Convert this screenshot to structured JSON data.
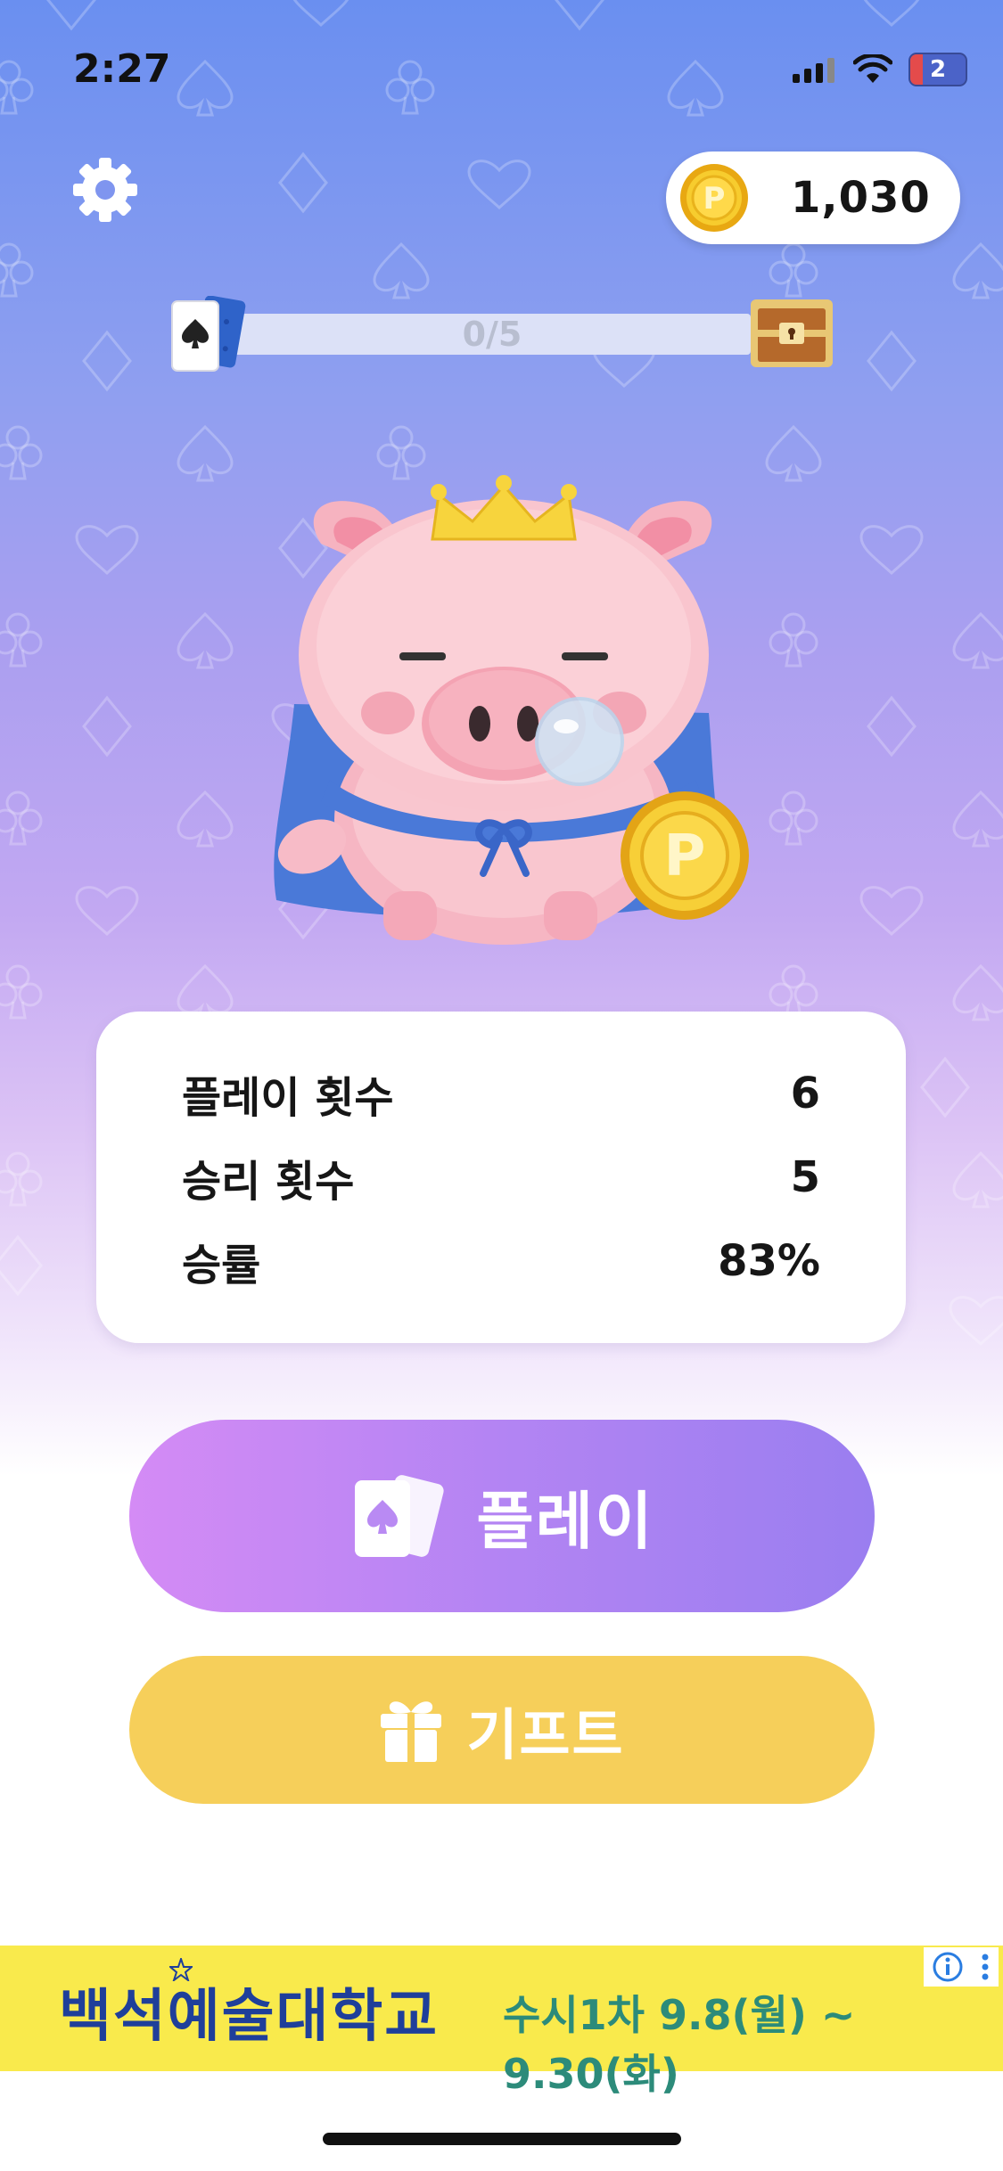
{
  "status_bar": {
    "time": "2:27",
    "battery_label": "2"
  },
  "header": {
    "coins": "1,030",
    "coin_symbol": "P"
  },
  "progress": {
    "label": "0/5",
    "fraction": 0.0
  },
  "stats": [
    {
      "label": "플레이 횟수",
      "value": "6"
    },
    {
      "label": "승리 횟수",
      "value": "5"
    },
    {
      "label": "승률",
      "value": "83%"
    }
  ],
  "actions": {
    "play_label": "플레이",
    "gift_label": "기프트"
  },
  "ad": {
    "school": "백석예술대학교",
    "dates": "수시1차 9.8(월) ~ 9.30(화)"
  },
  "colors": {
    "play_button": "#b384f3",
    "gift_button": "#f6cf5a",
    "ad_background": "#f9ea4c",
    "accent_blue": "#6a8ff0"
  },
  "icons": [
    "settings-gear-icon",
    "coin-icon",
    "spade-card-icon",
    "treasure-chest-icon",
    "gift-icon",
    "info-icon",
    "more-options-icon"
  ]
}
